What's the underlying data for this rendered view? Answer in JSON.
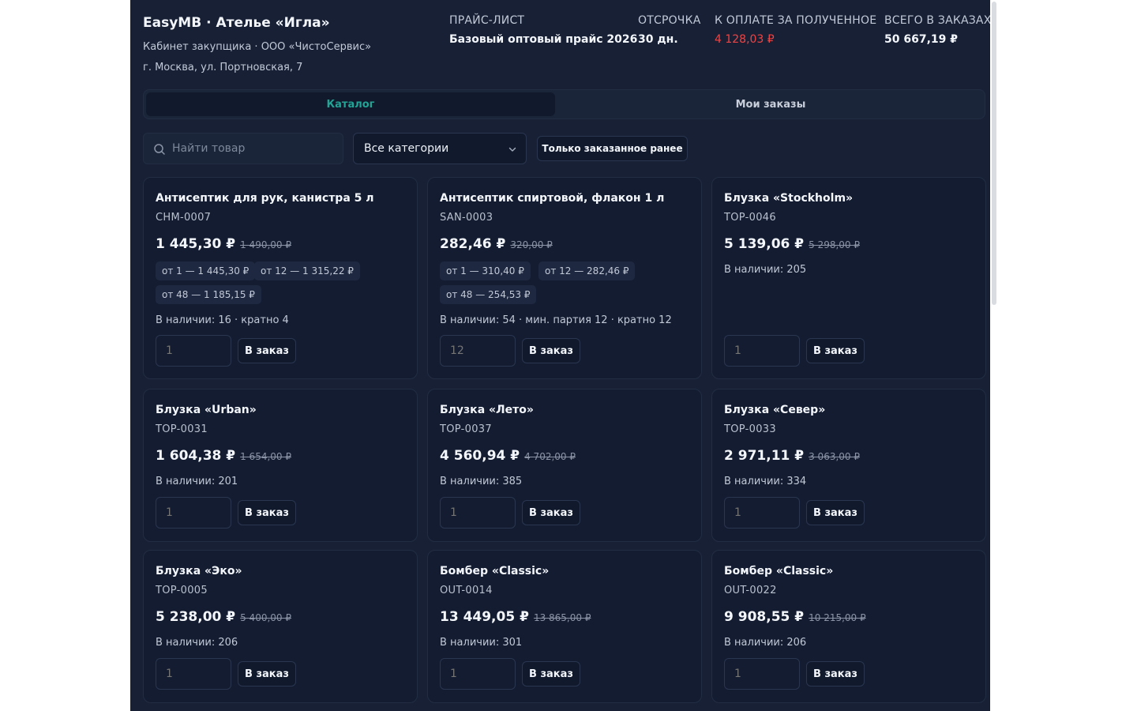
{
  "header": {
    "title": "EasyMB · Ателье «Игла»",
    "subtitle": "Кабинет закупщика · ООО «ЧистоСервис»",
    "address": "г. Москва, ул. Портновская, 7",
    "price_list_label": "ПРАЙС-ЛИСТ",
    "price_list_value": "Базовый оптовый прайс 2026",
    "deferral_label": "ОТСРОЧКА",
    "deferral_value": "30 дн.",
    "due_label": "К ОПЛАТЕ ЗА ПОЛУЧЕННОЕ",
    "due_value": "4 128,03 ₽",
    "total_label": "ВСЕГО В ЗАКАЗАХ",
    "total_value": "50 667,19 ₽"
  },
  "colors": {
    "accent": "#21a495",
    "danger": "#ef4444",
    "background": "#172035",
    "card": "#131c30"
  },
  "tabs": [
    {
      "label": "Каталог",
      "active": true
    },
    {
      "label": "Мои заказы",
      "active": false
    }
  ],
  "filters": {
    "search_placeholder": "Найти товар",
    "search_icon": "search-icon",
    "category_selected": "Все категории",
    "ordered_before_label": "Только заказанное ранее"
  },
  "add_label": "В заказ",
  "products": [
    {
      "name": "Антисептик для рук, канистра 5 л",
      "sku": "CHM-0007",
      "price": "1 445,30 ₽",
      "old_price": "1 490,00 ₽",
      "tiers": [
        "от 1 — 1 445,30 ₽",
        "от 12 — 1 315,22 ₽",
        "от 48 — 1 185,15 ₽"
      ],
      "stock": "В наличии: 16 · кратно 4",
      "qty_placeholder": "1"
    },
    {
      "name": "Антисептик спиртовой, флакон 1 л",
      "sku": "SAN-0003",
      "price": "282,46 ₽",
      "old_price": "320,00 ₽",
      "tiers": [
        "от 1 — 310,40 ₽",
        "от 12 — 282,46 ₽",
        "от 48 — 254,53 ₽"
      ],
      "stock": "В наличии: 54 · мин. партия 12 · кратно 12",
      "qty_placeholder": "12"
    },
    {
      "name": "Блузка «Stockholm»",
      "sku": "TOP-0046",
      "price": "5 139,06 ₽",
      "old_price": "5 298,00 ₽",
      "tiers": [],
      "stock": "В наличии: 205",
      "qty_placeholder": "1"
    },
    {
      "name": "Блузка «Urban»",
      "sku": "TOP-0031",
      "price": "1 604,38 ₽",
      "old_price": "1 654,00 ₽",
      "tiers": [],
      "stock": "В наличии: 201",
      "qty_placeholder": "1"
    },
    {
      "name": "Блузка «Лето»",
      "sku": "TOP-0037",
      "price": "4 560,94 ₽",
      "old_price": "4 702,00 ₽",
      "tiers": [],
      "stock": "В наличии: 385",
      "qty_placeholder": "1"
    },
    {
      "name": "Блузка «Север»",
      "sku": "TOP-0033",
      "price": "2 971,11 ₽",
      "old_price": "3 063,00 ₽",
      "tiers": [],
      "stock": "В наличии: 334",
      "qty_placeholder": "1"
    },
    {
      "name": "Блузка «Эко»",
      "sku": "TOP-0005",
      "price": "5 238,00 ₽",
      "old_price": "5 400,00 ₽",
      "tiers": [],
      "stock": "В наличии: 206",
      "qty_placeholder": "1"
    },
    {
      "name": "Бомбер «Classic»",
      "sku": "OUT-0014",
      "price": "13 449,05 ₽",
      "old_price": "13 865,00 ₽",
      "tiers": [],
      "stock": "В наличии: 301",
      "qty_placeholder": "1"
    },
    {
      "name": "Бомбер «Classic»",
      "sku": "OUT-0022",
      "price": "9 908,55 ₽",
      "old_price": "10 215,00 ₽",
      "tiers": [],
      "stock": "В наличии: 206",
      "qty_placeholder": "1"
    }
  ]
}
